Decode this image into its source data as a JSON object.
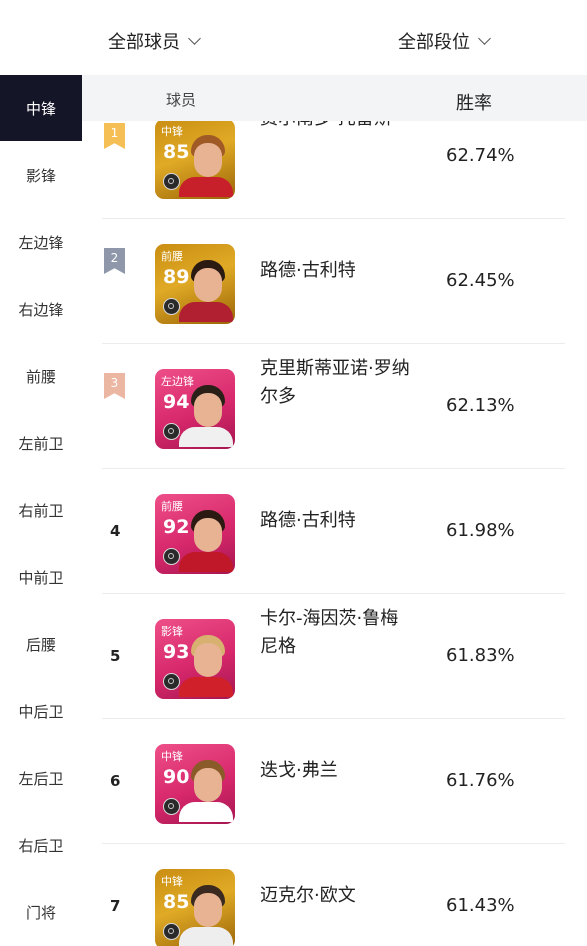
{
  "filters": {
    "players": "全部球员",
    "tiers": "全部段位"
  },
  "sidebar": {
    "items": [
      {
        "label": "中锋",
        "active": true
      },
      {
        "label": "影锋"
      },
      {
        "label": "左边锋"
      },
      {
        "label": "右边锋"
      },
      {
        "label": "前腰"
      },
      {
        "label": "左前卫"
      },
      {
        "label": "右前卫"
      },
      {
        "label": "中前卫"
      },
      {
        "label": "后腰"
      },
      {
        "label": "中后卫"
      },
      {
        "label": "左后卫"
      },
      {
        "label": "右后卫"
      },
      {
        "label": "门将"
      }
    ]
  },
  "table": {
    "headers": {
      "player": "球员",
      "win_rate": "胜率"
    },
    "rows": [
      {
        "rank": "1",
        "rank_style": "gold",
        "position": "中锋",
        "rating": "85",
        "card_color": "gold",
        "name": "费尔南多·托雷斯",
        "win_rate": "62.74%"
      },
      {
        "rank": "2",
        "rank_style": "silver",
        "position": "前腰",
        "rating": "89",
        "card_color": "gold",
        "name": "路德·古利特",
        "win_rate": "62.45%"
      },
      {
        "rank": "3",
        "rank_style": "bronze",
        "position": "左边锋",
        "rating": "94",
        "card_color": "pink",
        "name": "克里斯蒂亚诺·罗纳尔多",
        "win_rate": "62.13%"
      },
      {
        "rank": "4",
        "rank_style": "plain",
        "position": "前腰",
        "rating": "92",
        "card_color": "pink",
        "name": "路德·古利特",
        "win_rate": "61.98%"
      },
      {
        "rank": "5",
        "rank_style": "plain",
        "position": "影锋",
        "rating": "93",
        "card_color": "pink",
        "name": "卡尔-海因茨·鲁梅尼格",
        "win_rate": "61.83%"
      },
      {
        "rank": "6",
        "rank_style": "plain",
        "position": "中锋",
        "rating": "90",
        "card_color": "pink",
        "name": "迭戈·弗兰",
        "win_rate": "61.76%"
      },
      {
        "rank": "7",
        "rank_style": "plain",
        "position": "中锋",
        "rating": "85",
        "card_color": "gold",
        "name": "迈克尔·欧文",
        "win_rate": "61.43%"
      }
    ]
  },
  "colors": {
    "sidebar_active_bg": "#151528",
    "header_bg": "#f3f4f6",
    "rank_gold": "#f5bf55",
    "rank_silver": "#8f97ab",
    "rank_bronze": "#ebb6a2",
    "card_gold": "#d9a020",
    "card_pink": "#d7286c"
  }
}
